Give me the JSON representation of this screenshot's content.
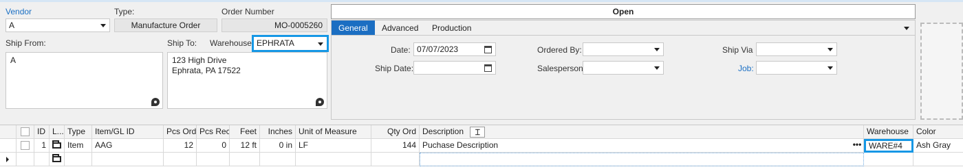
{
  "header": {
    "vendor_label": "Vendor",
    "vendor_value": "A",
    "type_label": "Type:",
    "type_value": "Manufacture Order",
    "order_number_label": "Order Number",
    "order_number_value": "MO-0005260",
    "status": "Open"
  },
  "ship": {
    "from_label": "Ship From:",
    "from_address": "A",
    "to_label": "Ship To:",
    "to_address_line1": "123 High Drive",
    "to_address_line2": "Ephrata, PA 17522",
    "warehouse_label": "Warehouse:",
    "warehouse_value": "EPHRATA"
  },
  "tabs": [
    "General",
    "Advanced",
    "Production"
  ],
  "general": {
    "date_label": "Date:",
    "date_value": "07/07/2023",
    "ship_date_label": "Ship Date:",
    "ship_date_value": "",
    "ordered_by_label": "Ordered By:",
    "ordered_by_value": "",
    "salesperson_label": "Salesperson",
    "salesperson_value": "",
    "ship_via_label": "Ship Via",
    "ship_via_value": "",
    "job_label": "Job:",
    "job_value": ""
  },
  "grid": {
    "columns": [
      "ID",
      "L...",
      "Type",
      "Item/GL ID",
      "Pcs Ord",
      "Pcs Rec",
      "Feet",
      "Inches",
      "Unit of Measure",
      "Qty Ord",
      "Description",
      "Warehouse",
      "Color"
    ],
    "rows": [
      {
        "id": "1",
        "type": "Item",
        "item": "AAG",
        "pcs_ord": "12",
        "pcs_rec": "0",
        "feet": "12 ft",
        "inches": "0 in",
        "uom": "LF",
        "qty_ord": "144",
        "description": "Puchase Description",
        "warehouse": "WARE#4",
        "color": "Ash Gray"
      }
    ],
    "ellipsis": "•••"
  },
  "colors": {
    "accent": "#1b6ec2",
    "highlight": "#1597e5"
  }
}
